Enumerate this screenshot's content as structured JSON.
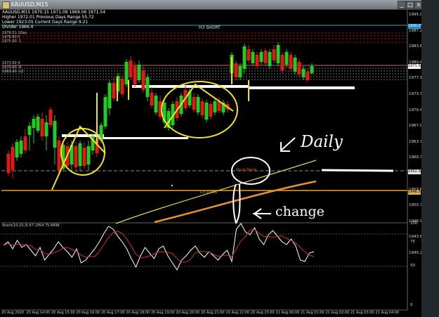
{
  "window": {
    "title": "XAUUSD,M15"
  },
  "info": {
    "symbol_line": "XAUUSD,M15  1970.15 1971.09 1969.06 1971.54",
    "high_line": "Higher 1972.01   Previous Days Range 55.72",
    "low_line": "Lower 1923.05   Current Days Range 9.21",
    "extra_line": "Divider 1966.4"
  },
  "labels": {
    "h3_short": "H3 SHORT",
    "pivot_point": "Pivot Point",
    "l3_long": "L3 LONG",
    "stoch": "Stoch(10,10,3) 67.1954 75.6696"
  },
  "level_labels": [
    "1979.51 1Day",
    "1976.60 0",
    "1975.60 -1",
    "1973.60 4",
    "1970.60 -8",
    "1969.60 -12"
  ],
  "price_axis": [
    "1995.05",
    "1987.20",
    "1983.80",
    "1980.45",
    "1977.10",
    "1973.75",
    "1970.40",
    "1967.05",
    "1963.70",
    "1960.35",
    "1957.00",
    "1953.65",
    "1950.30",
    "1946.95",
    "1943.60",
    "1940.25"
  ],
  "price_tags": [
    {
      "text": "1990.25",
      "color": "#1e90c8"
    },
    {
      "text": "1971.54",
      "color": "#ffffff"
    },
    {
      "text": "1952.30",
      "color": "#e5e5e5"
    },
    {
      "text": "1948.50",
      "color": "#d9b14a"
    }
  ],
  "stoch_axis": [
    "100",
    "75",
    "50",
    "0"
  ],
  "time_axis": [
    "20 Aug 2020",
    "20 Aug 14:00",
    "20 Aug 15:00",
    "20 Aug 16:00",
    "20 Aug 17:00",
    "20 Aug 18:00",
    "20 Aug 19:00",
    "20 Aug 20:00",
    "20 Aug 21:00",
    "20 Aug 22:00",
    "20 Aug 23:00",
    "21 Aug 00:00",
    "21 Aug 01:00",
    "21 Aug 02:00",
    "21 Aug 03:00",
    "21 Aug 04:00"
  ],
  "annotations": {
    "daily": "Daily",
    "change": "change"
  },
  "colors": {
    "bull": "#22cc22",
    "bear": "#e01919",
    "stoch": "#ffffff",
    "signal": "#c0392b",
    "annotation": "#f2e02a",
    "pivot": "#e06020"
  }
}
